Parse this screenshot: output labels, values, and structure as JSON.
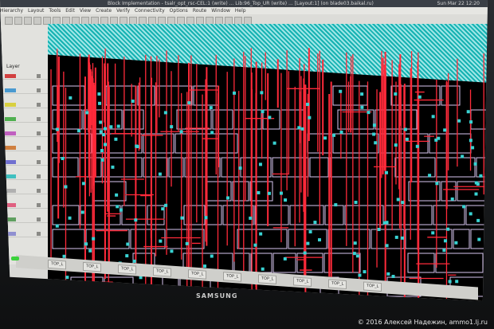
{
  "window": {
    "title": "Block Implementation - tsalr_opt_rsc-CEL:1 (write) ... Lib:96_Top_UR (write) ... [Layout:1] (on blade03.baikal.ru)",
    "clock": "Sun Mar 22 12:20"
  },
  "menubar": {
    "items": [
      "Hierarchy",
      "Layout",
      "Tools",
      "Edit",
      "View",
      "Create",
      "Verify",
      "Connectivity",
      "Options",
      "Route",
      "Window",
      "Help"
    ]
  },
  "left_panel": {
    "title": "Layer",
    "layer_colors": [
      "#d24040",
      "#4a9ad0",
      "#d8d040",
      "#50b050",
      "#c060c0",
      "#d08040",
      "#7070d0",
      "#40c0c0",
      "#b0b0b0",
      "#e06080",
      "#60a060",
      "#9090d0"
    ]
  },
  "status_tabs": [
    "TOP_L",
    "TOP_L",
    "TOP_L",
    "TOP_L",
    "TOP_L",
    "TOP_L",
    "TOP_L",
    "TOP_L",
    "TOP_L",
    "TOP_L"
  ],
  "monitor": {
    "brand": "SAMSUNG"
  },
  "photo": {
    "credit": "© 2016 Алексей Надежин, ammo1.lj.ru"
  },
  "colors": {
    "wire": "#ff2a3a",
    "cell_outline": "#d8c6f0",
    "via": "#39d3d3",
    "hatch": "#16b2b2"
  }
}
